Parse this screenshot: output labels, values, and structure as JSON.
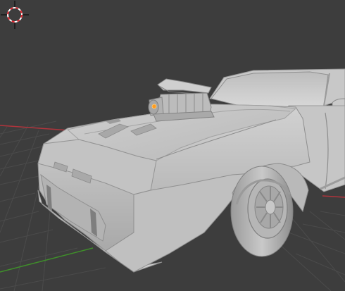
{
  "viewport": {
    "name": "3D Viewport",
    "background_color": "#3d3d3d",
    "grid_color": "#4a4a4a",
    "x_axis_color": "#b0343c",
    "y_axis_color": "#3f8f2a",
    "object_color": "#c4c4c4"
  },
  "icons": {
    "cursor": "3d-cursor-icon"
  },
  "scene": {
    "objects": [
      {
        "label": "car-model",
        "kind": "mesh"
      },
      {
        "label": "supercharger",
        "kind": "mesh"
      }
    ]
  }
}
